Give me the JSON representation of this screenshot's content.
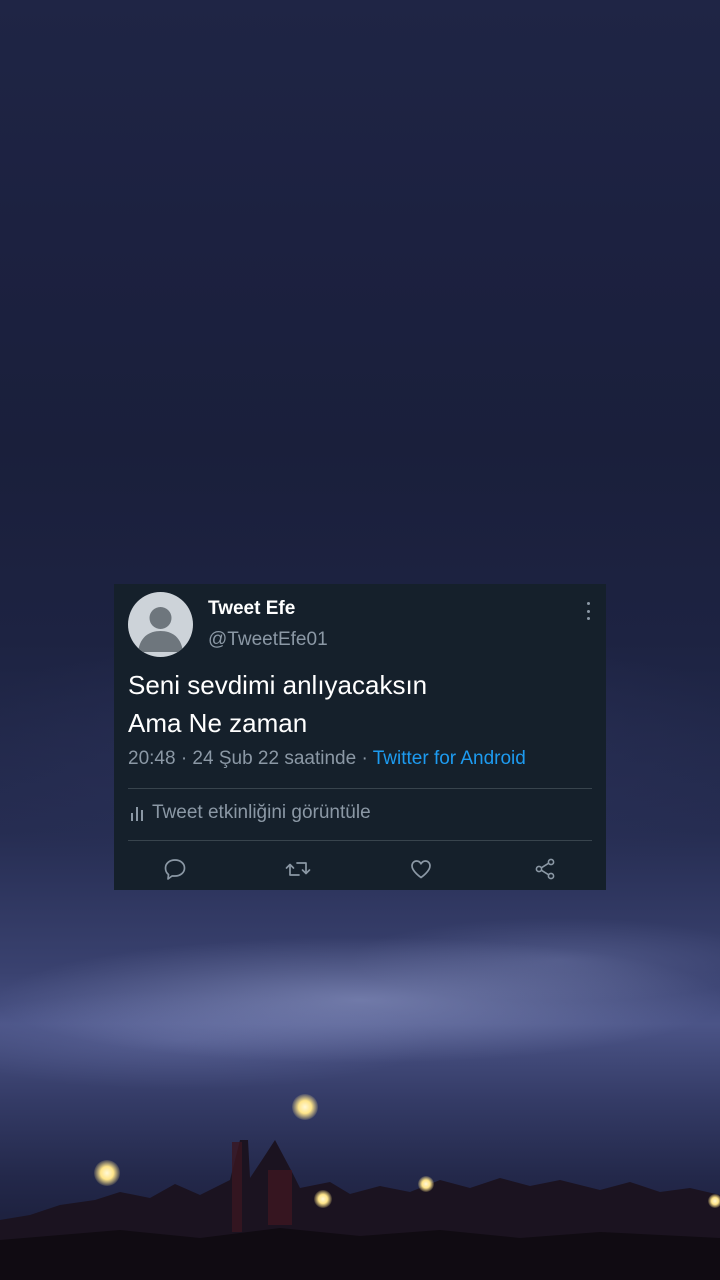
{
  "tweet": {
    "display_name": "Tweet Efe",
    "handle": "@TweetEfe01",
    "text_lines": [
      "Seni sevdimi anlıyacaksın",
      "Ama Ne zaman"
    ],
    "timestamp": "20:48 · 24 Şub 22 saatinde · ",
    "source": "Twitter for Android",
    "activity_label": "Tweet etkinliğini görüntüle",
    "actions": {
      "reply_icon": "comment-bubble",
      "retweet_icon": "retweet-arrows",
      "like_icon": "heart",
      "share_icon": "share-nodes"
    }
  },
  "colors": {
    "card_background": "#15202b",
    "secondary_text": "#8b98a5",
    "link": "#1d9bf0",
    "divider": "#38444d"
  }
}
